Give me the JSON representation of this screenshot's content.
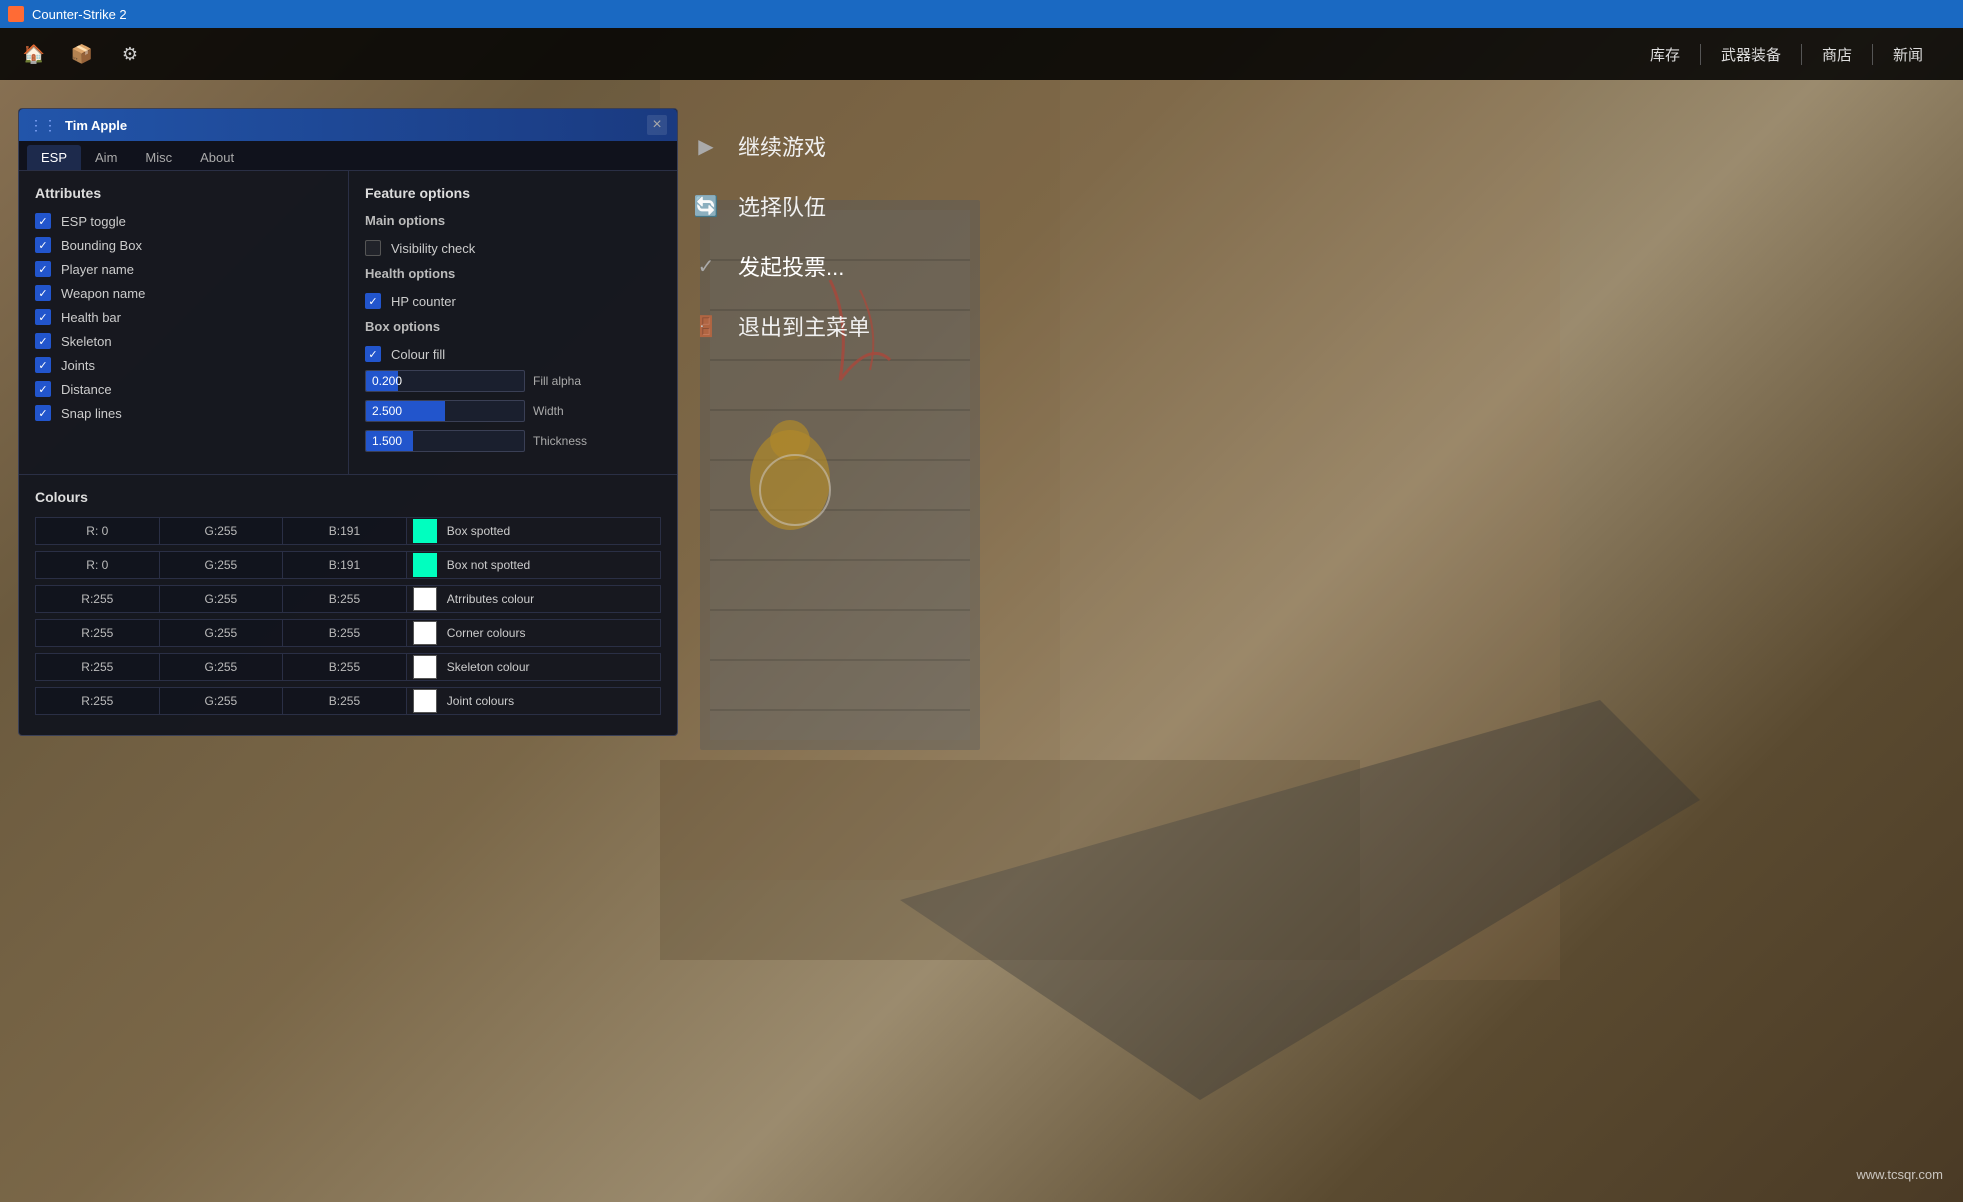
{
  "titleBar": {
    "title": "Counter-Strike 2"
  },
  "topNav": {
    "icons": [
      "🏠",
      "📦",
      "⚙"
    ],
    "links": [
      "库存",
      "武器装备",
      "商店",
      "新闻"
    ]
  },
  "gameMenu": {
    "items": [
      {
        "icon": "▶",
        "text": "继续游戏",
        "active": false
      },
      {
        "icon": "🔄",
        "text": "选择队伍",
        "active": false
      },
      {
        "icon": "✓",
        "text": "发起投票...",
        "active": true
      },
      {
        "icon": "🚪",
        "text": "退出到主菜单",
        "active": false
      }
    ]
  },
  "espPanel": {
    "title": "Tim Apple",
    "closeLabel": "×",
    "tabs": [
      "ESP",
      "Aim",
      "Misc",
      "About"
    ],
    "activeTab": "ESP",
    "attributes": {
      "title": "Attributes",
      "items": [
        {
          "label": "ESP toggle",
          "checked": true
        },
        {
          "label": "Bounding Box",
          "checked": true
        },
        {
          "label": "Player name",
          "checked": true
        },
        {
          "label": "Weapon name",
          "checked": true
        },
        {
          "label": "Health bar",
          "checked": true
        },
        {
          "label": "Skeleton",
          "checked": true
        },
        {
          "label": "Joints",
          "checked": true
        },
        {
          "label": "Distance",
          "checked": true
        },
        {
          "label": "Snap lines",
          "checked": true
        }
      ]
    },
    "featureOptions": {
      "title": "Feature options",
      "mainOptions": {
        "title": "Main options",
        "items": [
          {
            "label": "Visibility check",
            "checked": false
          }
        ]
      },
      "healthOptions": {
        "title": "Health options",
        "items": [
          {
            "label": "HP counter",
            "checked": true
          }
        ]
      },
      "boxOptions": {
        "title": "Box options",
        "items": [
          {
            "label": "Colour fill",
            "checked": true
          }
        ],
        "sliders": [
          {
            "label": "Fill alpha",
            "value": "0.200",
            "fillPct": 20
          },
          {
            "label": "Width",
            "value": "2.500",
            "fillPct": 50
          },
          {
            "label": "Thickness",
            "value": "1.500",
            "fillPct": 30
          }
        ]
      }
    },
    "colours": {
      "title": "Colours",
      "rows": [
        {
          "r": "R:  0",
          "g": "G:255",
          "b": "B:191",
          "swatch": "#00ffbf",
          "name": "Box spotted"
        },
        {
          "r": "R:  0",
          "g": "G:255",
          "b": "B:191",
          "swatch": "#00ffbf",
          "name": "Box not spotted"
        },
        {
          "r": "R:255",
          "g": "G:255",
          "b": "B:255",
          "swatch": "#ffffff",
          "name": "Atrributes colour"
        },
        {
          "r": "R:255",
          "g": "G:255",
          "b": "B:255",
          "swatch": "#ffffff",
          "name": "Corner colours"
        },
        {
          "r": "R:255",
          "g": "G:255",
          "b": "B:255",
          "swatch": "#ffffff",
          "name": "Skeleton colour"
        },
        {
          "r": "R:255",
          "g": "G:255",
          "b": "B:255",
          "swatch": "#ffffff",
          "name": "Joint colours"
        }
      ]
    }
  },
  "watermark": "www.tcsqr.com"
}
